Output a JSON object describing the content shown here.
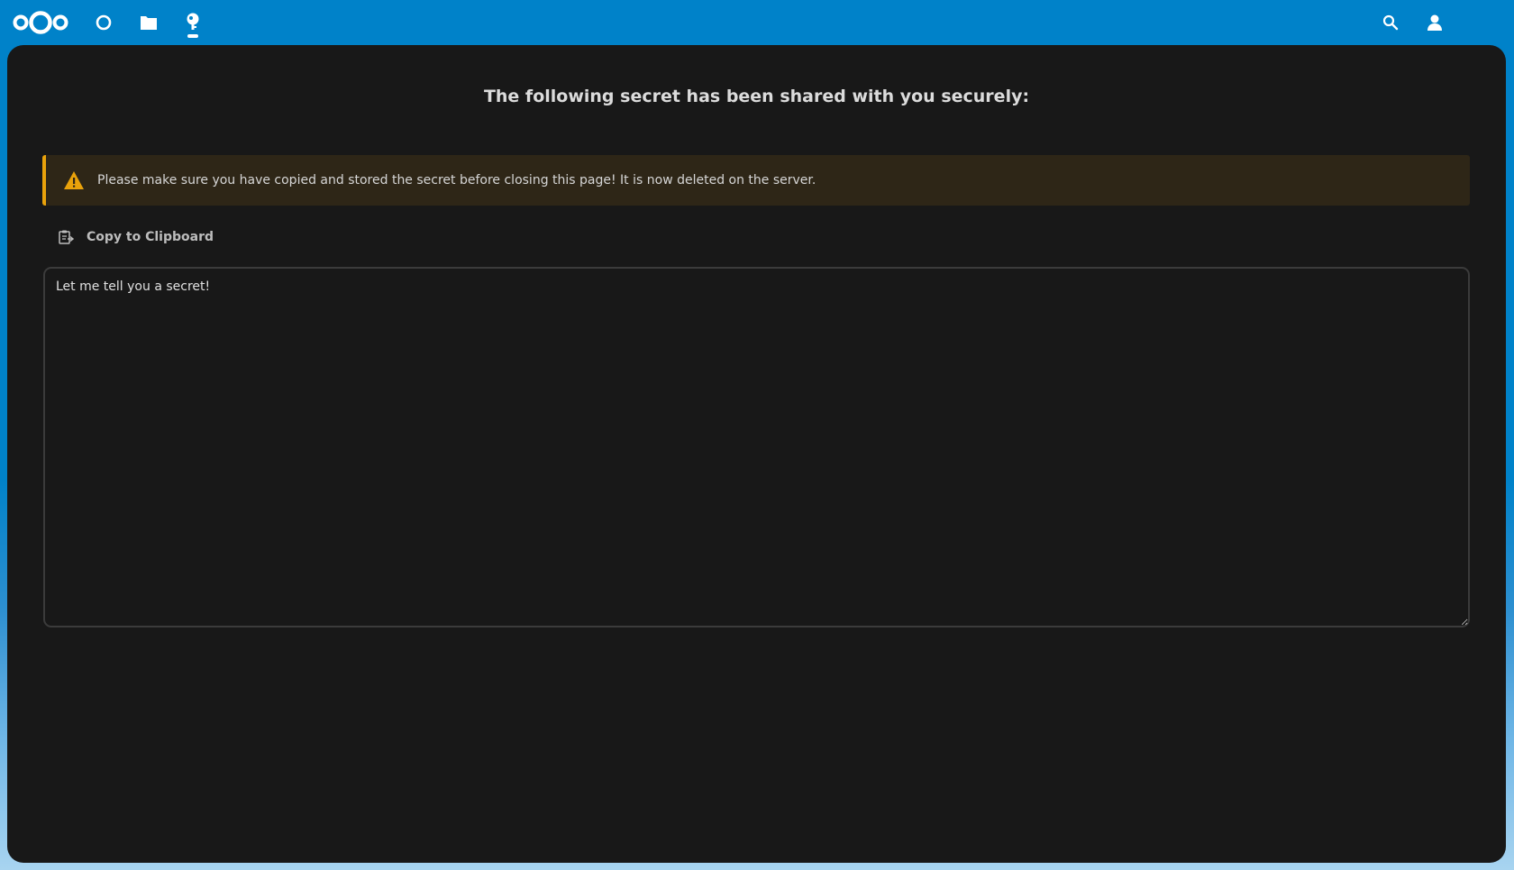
{
  "header": {
    "logo_icon": "nextcloud-logo",
    "nav": [
      {
        "icon": "dashboard-icon",
        "active": false
      },
      {
        "icon": "files-icon",
        "active": false
      },
      {
        "icon": "secrets-icon",
        "active": true
      }
    ],
    "right_icons": [
      "search-icon",
      "user-menu-icon"
    ],
    "accent_color": "#0082c9"
  },
  "main": {
    "title": "The following secret has been shared with you securely:",
    "warning": {
      "icon": "warning-triangle-icon",
      "color": "#e9a20b",
      "text": "Please make sure you have copied and stored the secret before closing this page! It is now deleted on the server."
    },
    "copy_button": {
      "icon": "clipboard-icon",
      "label": "Copy to Clipboard"
    },
    "secret_text": "Let me tell you a secret!"
  }
}
